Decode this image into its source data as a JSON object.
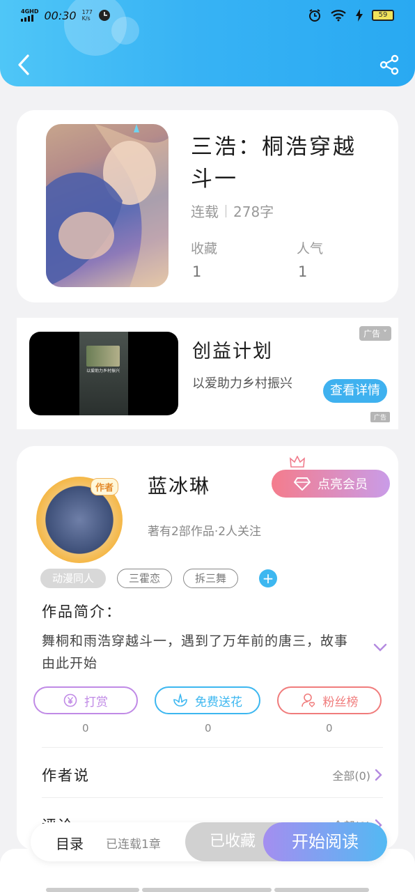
{
  "status_bar": {
    "network": "4GHD",
    "time": "00:30",
    "speed_value": "177",
    "speed_unit": "K/s",
    "battery": "59"
  },
  "nav": {
    "back_icon": "back-arrow-icon",
    "share_icon": "share-icon"
  },
  "book": {
    "title": "三浩：桐浩穿越斗一",
    "status": "连载",
    "word_count": "278字",
    "favorites_label": "收藏",
    "favorites_value": "1",
    "popularity_label": "人气",
    "popularity_value": "1"
  },
  "ad": {
    "badge": "广告",
    "title": "创益计划",
    "description": "以爱助力乡村振兴",
    "cta": "查看详情",
    "source": "广告",
    "video_caption": "以爱助力乡村振兴"
  },
  "author": {
    "badge": "作者",
    "name": "蓝冰琳",
    "vip_button": "点亮会员",
    "meta": "著有2部作品·2人关注",
    "tags": [
      "动漫同人",
      "三霍恋",
      "拆三舞"
    ],
    "tag_add": "+",
    "intro_label": "作品简介：",
    "intro_text": "舞桐和雨浩穿越斗一，遇到了万年前的唐三，故事由此开始",
    "actions": [
      {
        "label": "打赏",
        "count": "0",
        "icon": "yen-coin-icon",
        "color": "#c08ae6"
      },
      {
        "label": "免费送花",
        "count": "0",
        "icon": "flower-icon",
        "color": "#3db7f0"
      },
      {
        "label": "粉丝榜",
        "count": "0",
        "icon": "fan-user-icon",
        "color": "#f07c7c"
      }
    ],
    "author_says_label": "作者说",
    "author_says_more": "全部(0)",
    "comments_label": "评论",
    "comments_more": "全部(0)"
  },
  "bottom_bar": {
    "toc": "目录",
    "serial": "已连载1章",
    "collected": "已收藏",
    "read": "开始阅读"
  },
  "colors": {
    "header_blue": "#38b3f4",
    "accent_blue": "#3db7f0",
    "vip_gradient_start": "#f47c8c",
    "vip_gradient_end": "#c99ce8"
  }
}
